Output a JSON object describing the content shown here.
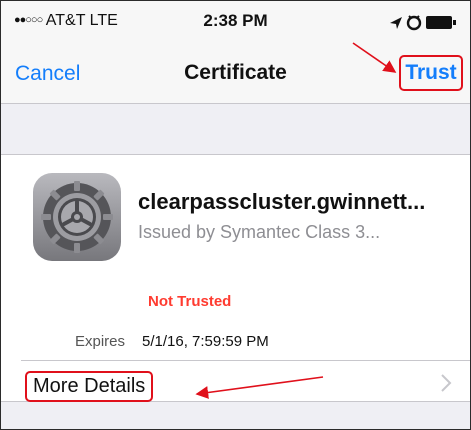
{
  "status_bar": {
    "carrier": "AT&T",
    "network": "LTE",
    "time": "2:38 PM",
    "signal_dots": "●●○○○"
  },
  "nav": {
    "cancel_label": "Cancel",
    "title": "Certificate",
    "trust_label": "Trust"
  },
  "certificate": {
    "name": "clearpasscluster.gwinnett...",
    "issuer": "Issued by Symantec Class 3...",
    "trust_status": "Not Trusted",
    "expires_label": "Expires",
    "expires_value": "5/1/16, 7:59:59 PM"
  },
  "details_row": {
    "label": "More Details"
  },
  "colors": {
    "ios_blue": "#147efb",
    "warning_red": "#ff3b30",
    "annotation_red": "#e0101b"
  },
  "icons": [
    "location-arrow-icon",
    "alarm-clock-icon",
    "battery-icon",
    "settings-gear-icon",
    "chevron-right-icon"
  ]
}
